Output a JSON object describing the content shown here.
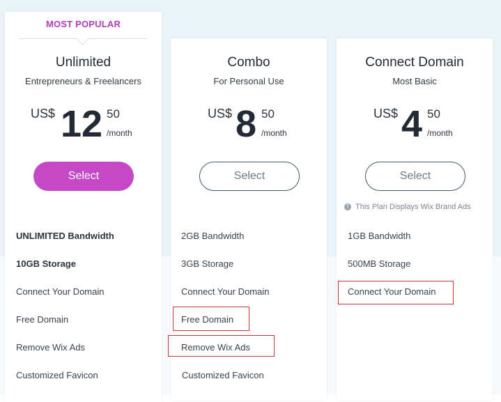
{
  "colors": {
    "accent": "#c548c6",
    "badge": "#b03bbb",
    "outline": "#41596f",
    "highlight_box": "#c9363a",
    "page_background": "#e9f3f8"
  },
  "plans": [
    {
      "badge": "MOST POPULAR",
      "name": "Unlimited",
      "tagline": "Entrepreneurs & Freelancers",
      "currency": "US$",
      "amount": "12",
      "cents": "50",
      "period": "/month",
      "button_label": "Select",
      "button_style": "filled",
      "features": [
        "UNLIMITED Bandwidth",
        "10GB Storage",
        "Connect Your Domain",
        "Free Domain",
        "Remove Wix Ads",
        "Customized Favicon"
      ]
    },
    {
      "name": "Combo",
      "tagline": "For Personal Use",
      "currency": "US$",
      "amount": "8",
      "cents": "50",
      "period": "/month",
      "button_label": "Select",
      "button_style": "outline",
      "features": [
        "2GB Bandwidth",
        "3GB Storage",
        "Connect Your Domain",
        "Free Domain",
        "Remove Wix Ads",
        "Customized Favicon"
      ],
      "highlighted_features": [
        "Free Domain",
        "Remove Wix Ads"
      ]
    },
    {
      "name": "Connect Domain",
      "tagline": "Most Basic",
      "currency": "US$",
      "amount": "4",
      "cents": "50",
      "period": "/month",
      "button_label": "Select",
      "button_style": "outline",
      "notice": "This Plan Displays Wix Brand Ads",
      "notice_icon": "info-icon",
      "features": [
        "1GB Bandwidth",
        "500MB Storage",
        "Connect Your Domain"
      ],
      "highlighted_features": [
        "Connect Your Domain"
      ]
    }
  ]
}
